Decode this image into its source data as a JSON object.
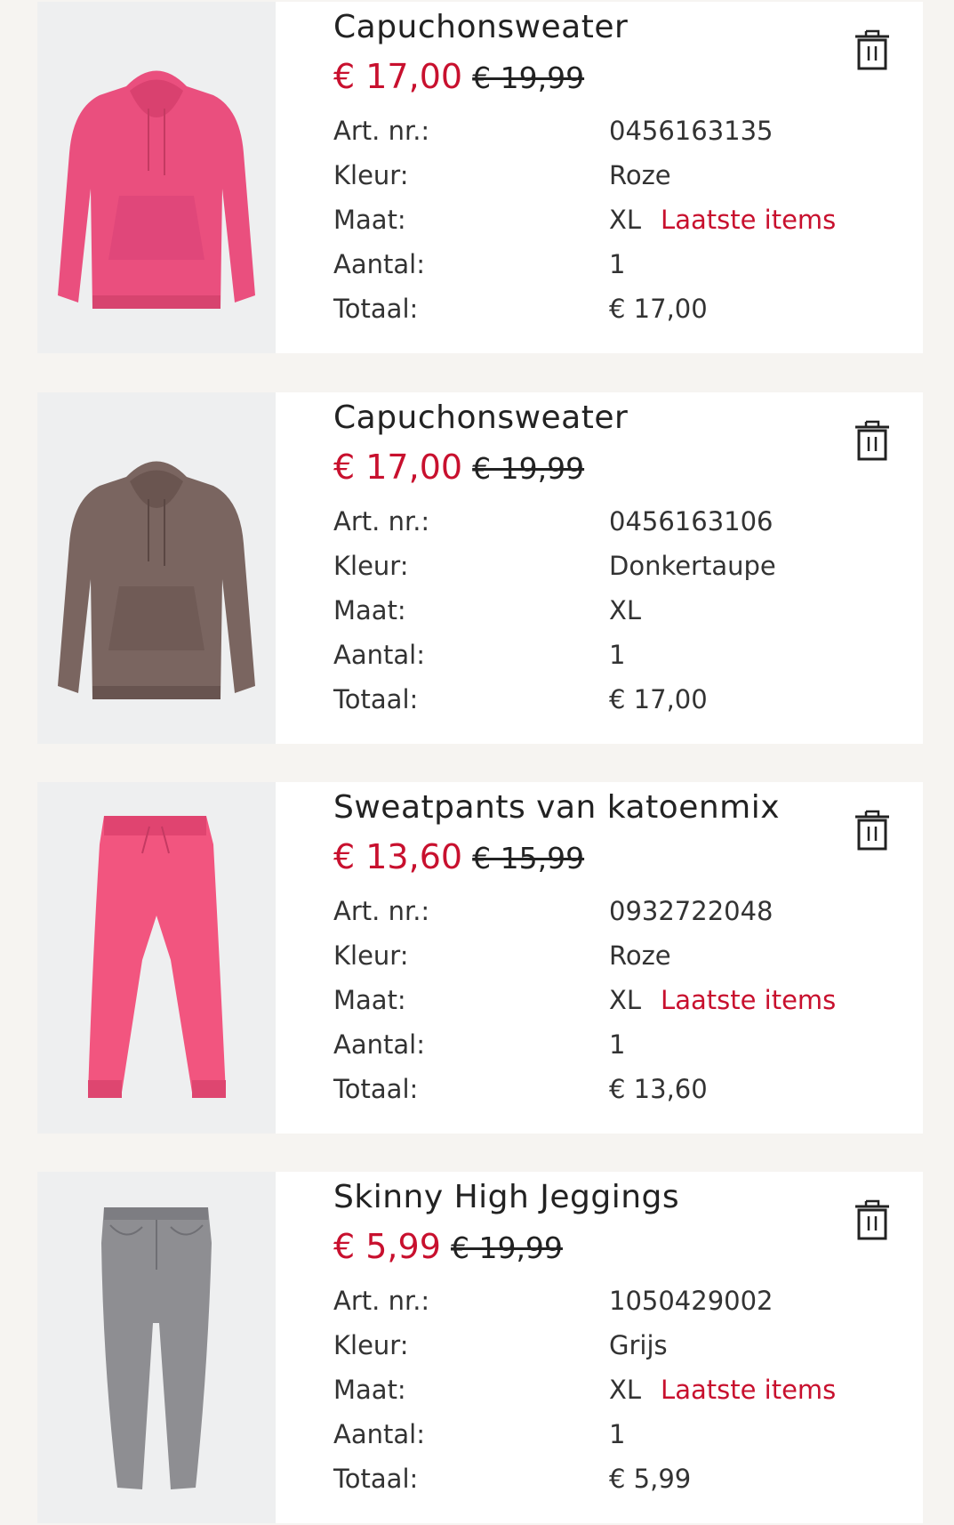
{
  "colors": {
    "sale_red": "#c8102e",
    "text": "#222222",
    "page_bg": "#f6f4f1",
    "card_bg": "#ffffff",
    "image_bg": "#eeeff0"
  },
  "labels": {
    "article": "Art. nr.:",
    "color": "Kleur:",
    "size": "Maat:",
    "quantity": "Aantal:",
    "total": "Totaal:"
  },
  "items": [
    {
      "image": "pink-hoodie",
      "title": "Capuchonsweater",
      "price": "€ 17,00",
      "old_price": "€ 19,99",
      "article": "0456163135",
      "color": "Roze",
      "size": "XL",
      "stock_note": "Laatste items",
      "quantity": "1",
      "total": "€ 17,00",
      "delete_icon": "trash-icon"
    },
    {
      "image": "brown-hoodie",
      "title": "Capuchonsweater",
      "price": "€ 17,00",
      "old_price": "€ 19,99",
      "article": "0456163106",
      "color": "Donkertaupe",
      "size": "XL",
      "stock_note": "",
      "quantity": "1",
      "total": "€ 17,00",
      "delete_icon": "trash-icon"
    },
    {
      "image": "pink-sweatpants",
      "title": "Sweatpants van katoenmix",
      "price": "€ 13,60",
      "old_price": "€ 15,99",
      "article": "0932722048",
      "color": "Roze",
      "size": "XL",
      "stock_note": "Laatste items",
      "quantity": "1",
      "total": "€ 13,60",
      "delete_icon": "trash-icon"
    },
    {
      "image": "grey-jeggings",
      "title": "Skinny High Jeggings",
      "price": "€ 5,99",
      "old_price": "€ 19,99",
      "article": "1050429002",
      "color": "Grijs",
      "size": "XL",
      "stock_note": "Laatste items",
      "quantity": "1",
      "total": "€ 5,99",
      "delete_icon": "trash-icon"
    }
  ]
}
